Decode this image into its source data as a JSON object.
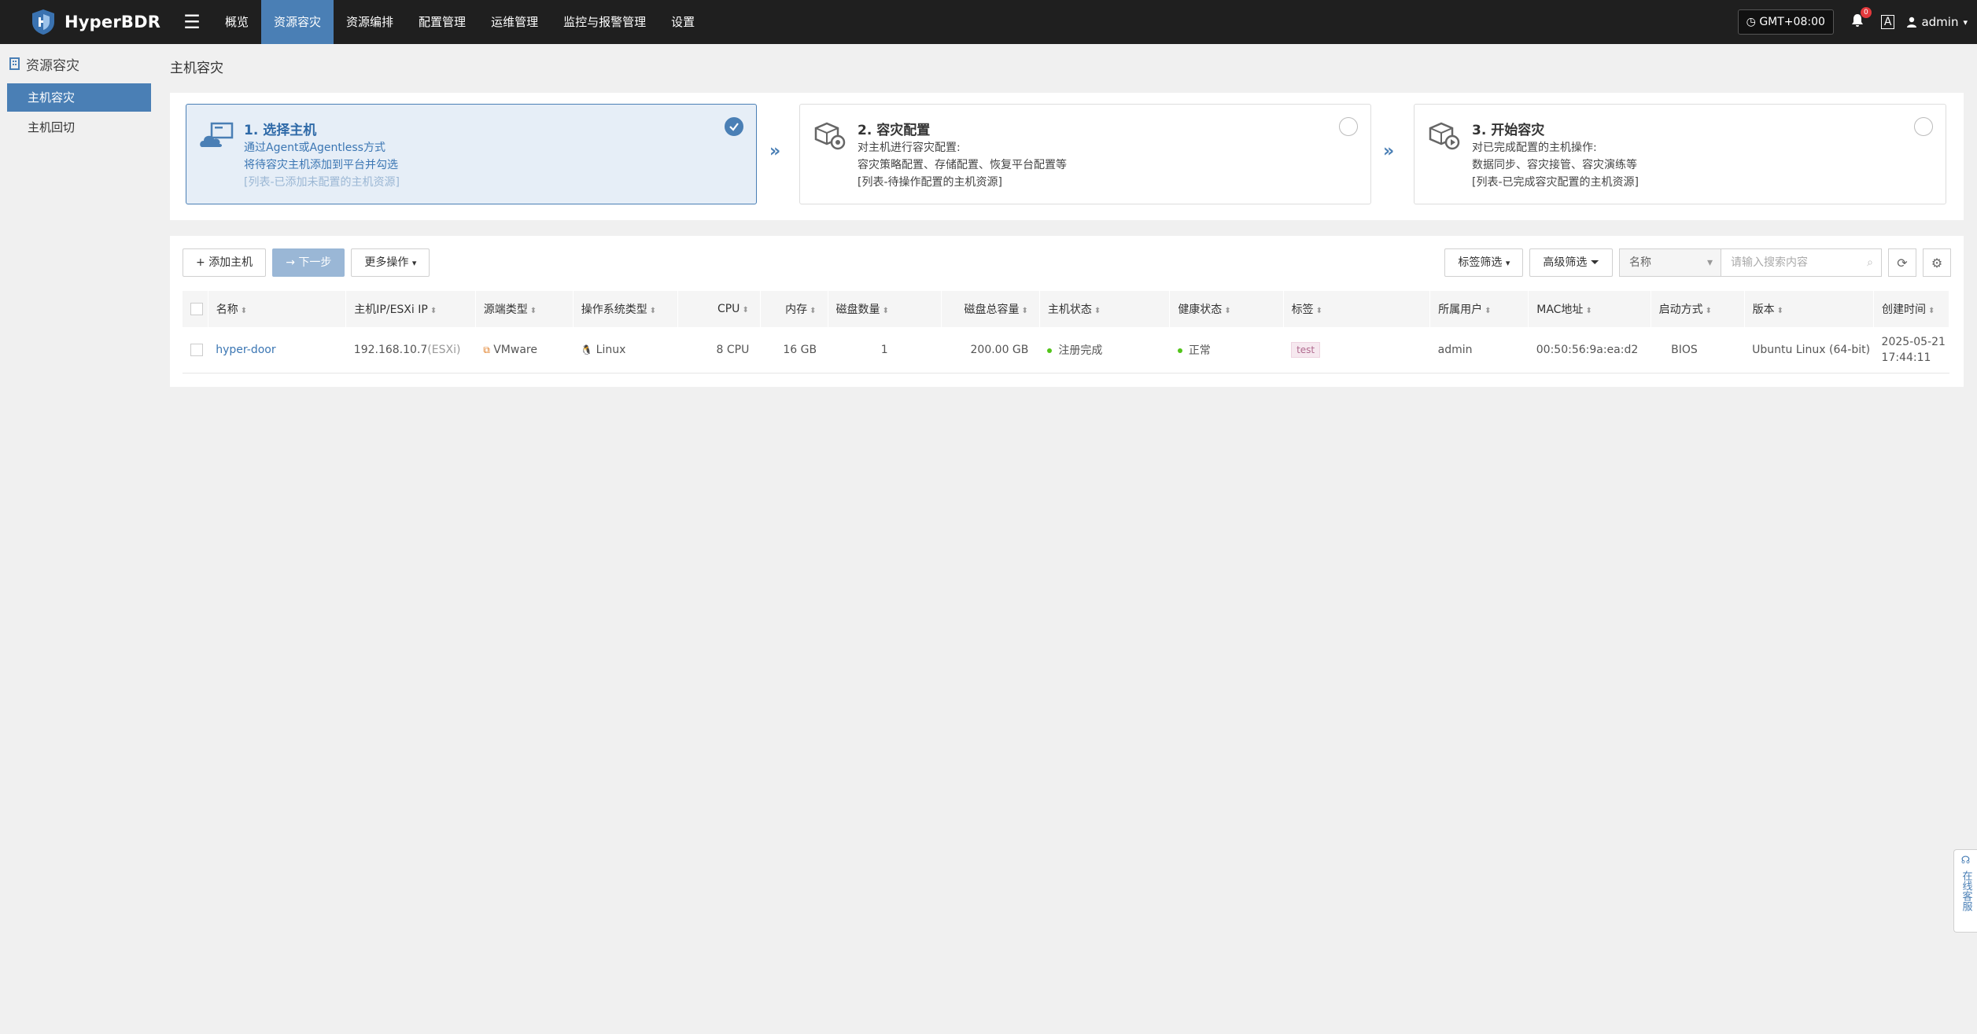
{
  "app": {
    "name": "HyperBDR"
  },
  "nav": {
    "menu_icon": "☰",
    "items": [
      "概览",
      "资源容灾",
      "资源编排",
      "配置管理",
      "运维管理",
      "监控与报警管理",
      "设置"
    ],
    "active_index": 1
  },
  "topbar": {
    "timezone": "GMT+08:00",
    "notification_count": "0",
    "lang": "A",
    "user": "admin"
  },
  "sidebar": {
    "title": "资源容灾",
    "items": [
      "主机容灾",
      "主机回切"
    ],
    "active_index": 0
  },
  "page": {
    "title": "主机容灾"
  },
  "steps": [
    {
      "title": "1. 选择主机",
      "lines": [
        "通过Agent或Agentless方式",
        "将待容灾主机添加到平台并勾选",
        "[列表-已添加未配置的主机资源]"
      ],
      "active": true
    },
    {
      "title": "2. 容灾配置",
      "lines": [
        "对主机进行容灾配置:",
        "容灾策略配置、存储配置、恢复平台配置等",
        "[列表-待操作配置的主机资源]"
      ],
      "active": false
    },
    {
      "title": "3. 开始容灾",
      "lines": [
        "对已完成配置的主机操作:",
        "数据同步、容灾接管、容灾演练等",
        "[列表-已完成容灾配置的主机资源]"
      ],
      "active": false
    }
  ],
  "toolbar": {
    "add_host": "添加主机",
    "next_step": "下一步",
    "more_actions": "更多操作",
    "tag_filter": "标签筛选",
    "advanced_filter": "高级筛选",
    "search_field": "名称",
    "search_placeholder": "请输入搜索内容"
  },
  "table": {
    "columns": [
      "名称",
      "主机IP/ESXi IP",
      "源端类型",
      "操作系统类型",
      "CPU",
      "内存",
      "磁盘数量",
      "磁盘总容量",
      "主机状态",
      "健康状态",
      "标签",
      "所属用户",
      "MAC地址",
      "启动方式",
      "版本",
      "创建时间"
    ],
    "rows": [
      {
        "name": "hyper-door",
        "ip": "192.168.10.7",
        "ip_suffix": "(ESXi)",
        "source_type": "VMware",
        "os_type": "Linux",
        "cpu": "8 CPU",
        "memory": "16 GB",
        "disk_count": "1",
        "disk_total": "200.00 GB",
        "host_status": "注册完成",
        "health_status": "正常",
        "tag": "test",
        "owner": "admin",
        "mac": "00:50:56:9a:ea:d2",
        "boot_mode": "BIOS",
        "version": "Ubuntu Linux (64-bit)",
        "created_date": "2025-05-21",
        "created_time": "17:44:11"
      }
    ]
  },
  "service": {
    "label": "在线客服"
  },
  "colors": {
    "accent": "#4a7fb5",
    "topbar": "#1f1f1f",
    "status_ok": "#52c41a"
  }
}
